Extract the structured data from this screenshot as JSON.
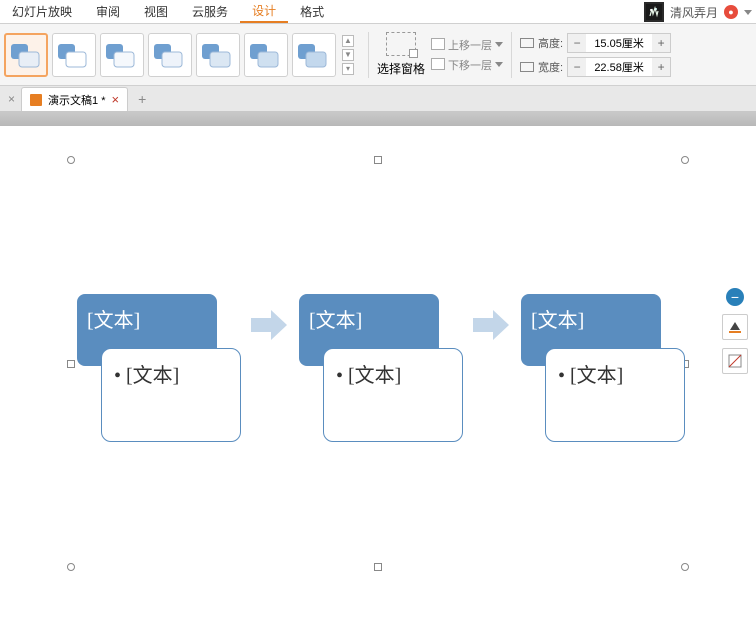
{
  "menubar": {
    "items": [
      "幻灯片放映",
      "审阅",
      "视图",
      "云服务",
      "设计",
      "格式"
    ],
    "active_index": 4
  },
  "user": {
    "name": "清风弄月"
  },
  "ribbon": {
    "pane_label": "选择窗格",
    "layer_up": "上移一层",
    "layer_down": "下移一层",
    "height_label": "高度:",
    "width_label": "宽度:",
    "height_value": "15.05厘米",
    "width_value": "22.58厘米"
  },
  "doc_tab": {
    "title": "演示文稿1 *"
  },
  "smartart": {
    "nodes": [
      {
        "title": "[文本]",
        "bullet": "[文本]"
      },
      {
        "title": "[文本]",
        "bullet": "[文本]"
      },
      {
        "title": "[文本]",
        "bullet": "[文本]"
      }
    ]
  }
}
